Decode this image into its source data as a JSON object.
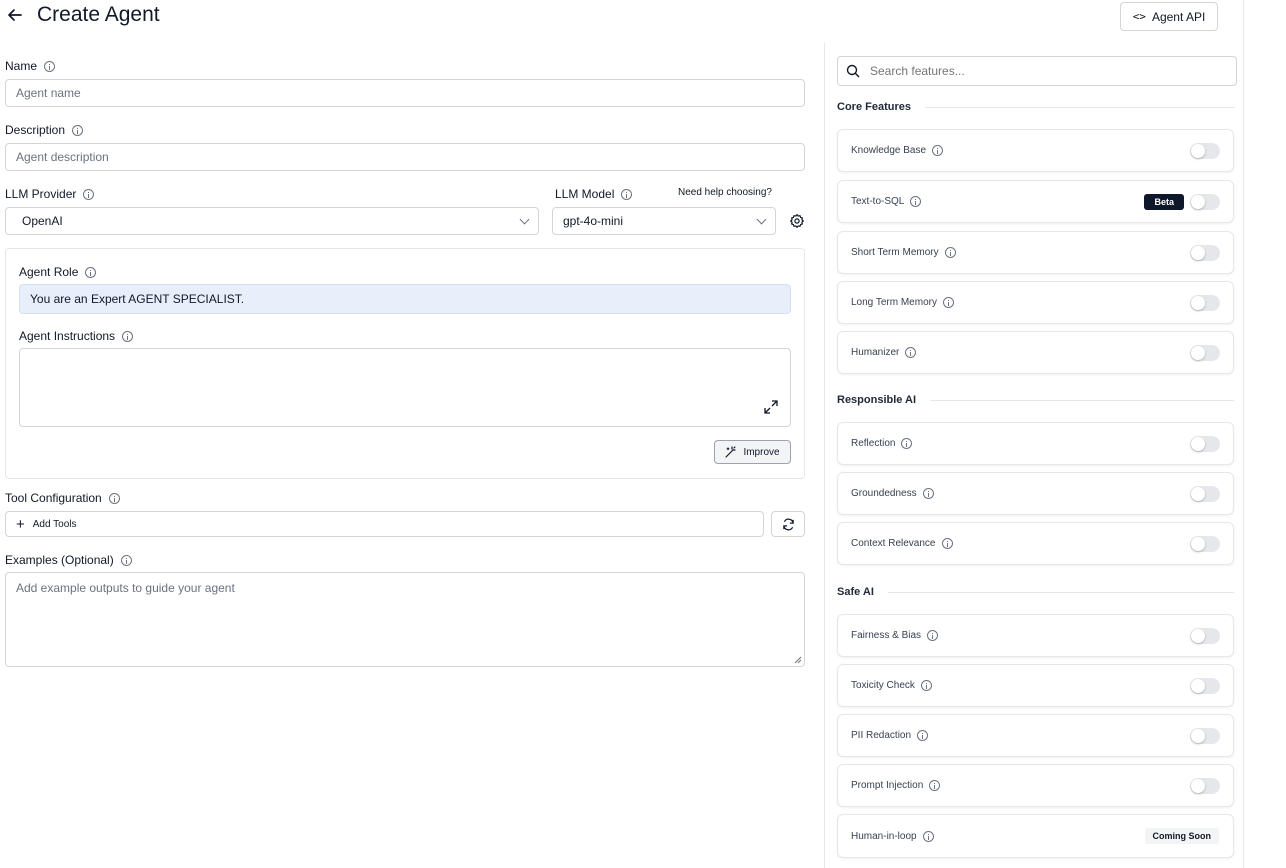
{
  "header": {
    "title": "Create Agent",
    "api_button_label": "Agent API"
  },
  "form": {
    "name": {
      "label": "Name",
      "placeholder": "Agent name"
    },
    "description": {
      "label": "Description",
      "placeholder": "Agent description"
    },
    "llm_provider": {
      "label": "LLM Provider",
      "value": "OpenAI"
    },
    "llm_model": {
      "label": "LLM Model",
      "value": "gpt-4o-mini",
      "help_link": "Need help choosing?"
    },
    "agent_role": {
      "label": "Agent Role",
      "value": "You are an Expert AGENT SPECIALIST."
    },
    "agent_instructions": {
      "label": "Agent Instructions",
      "value": ""
    },
    "improve_button_label": "Improve",
    "tool_configuration": {
      "label": "Tool Configuration",
      "add_tools_label": "Add Tools"
    },
    "examples": {
      "label": "Examples (Optional)",
      "placeholder": "Add example outputs to guide your agent"
    }
  },
  "features": {
    "search_placeholder": "Search features...",
    "sections": [
      {
        "title": "Core Features",
        "items": [
          {
            "name": "Knowledge Base",
            "enabled": false
          },
          {
            "name": "Text-to-SQL",
            "enabled": false,
            "badge": "Beta"
          },
          {
            "name": "Short Term Memory",
            "enabled": false
          },
          {
            "name": "Long Term Memory",
            "enabled": false
          },
          {
            "name": "Humanizer",
            "enabled": false
          }
        ]
      },
      {
        "title": "Responsible AI",
        "items": [
          {
            "name": "Reflection",
            "enabled": false
          },
          {
            "name": "Groundedness",
            "enabled": false
          },
          {
            "name": "Context Relevance",
            "enabled": false
          }
        ]
      },
      {
        "title": "Safe AI",
        "items": [
          {
            "name": "Fairness & Bias",
            "enabled": false
          },
          {
            "name": "Toxicity Check",
            "enabled": false
          },
          {
            "name": "PII Redaction",
            "enabled": false
          },
          {
            "name": "Prompt Injection",
            "enabled": false
          },
          {
            "name": "Human-in-loop",
            "status": "Coming Soon"
          }
        ]
      }
    ]
  },
  "colors": {
    "primary_dark": "#0f172a",
    "role_field_bg": "#e8effb",
    "toggle_off": "#e5e7eb"
  }
}
